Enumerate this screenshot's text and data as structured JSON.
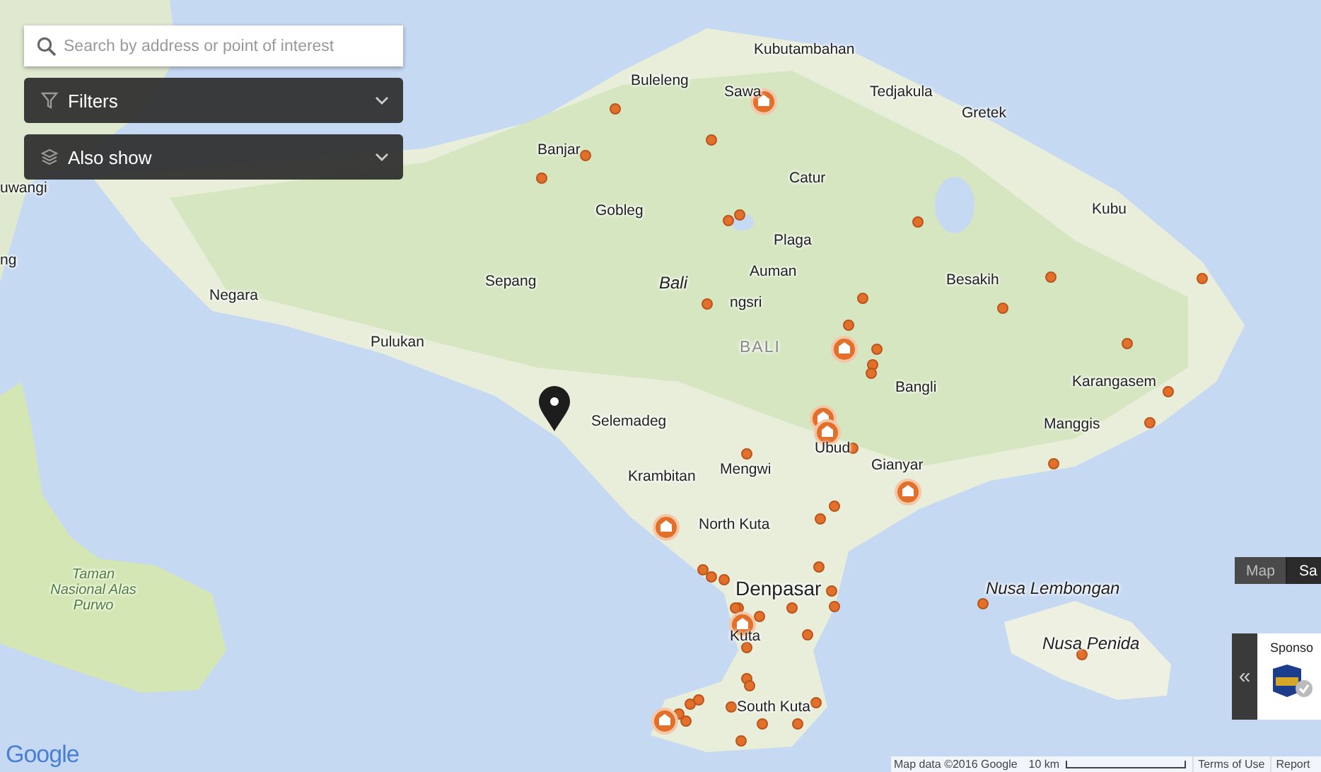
{
  "search": {
    "placeholder": "Search by address or point of interest"
  },
  "panels": [
    {
      "label": "Filters",
      "kind": "filter"
    },
    {
      "label": "Also show",
      "kind": "layers"
    }
  ],
  "map": {
    "labels": [
      {
        "text": "Kubutambahan",
        "kind": "town"
      },
      {
        "text": "Buleleng",
        "kind": "town"
      },
      {
        "text": "Sawa",
        "kind": "town"
      },
      {
        "text": "Tedjakula",
        "kind": "town"
      },
      {
        "text": "Gretek",
        "kind": "town"
      },
      {
        "text": "Banjar",
        "kind": "town"
      },
      {
        "text": "Catur",
        "kind": "town"
      },
      {
        "text": "Gobleg",
        "kind": "town"
      },
      {
        "text": "Kubu",
        "kind": "town"
      },
      {
        "text": "Plaga",
        "kind": "town"
      },
      {
        "text": "Auman",
        "kind": "town"
      },
      {
        "text": "Bali",
        "kind": "region"
      },
      {
        "text": "ngsri",
        "kind": "town"
      },
      {
        "text": "Negara",
        "kind": "town"
      },
      {
        "text": "Sepang",
        "kind": "town"
      },
      {
        "text": "BALI",
        "kind": "province"
      },
      {
        "text": "Besakih",
        "kind": "town"
      },
      {
        "text": "Pulukan",
        "kind": "town"
      },
      {
        "text": "Karangasem",
        "kind": "town"
      },
      {
        "text": "Bangli",
        "kind": "town"
      },
      {
        "text": "Manggis",
        "kind": "town"
      },
      {
        "text": "Selemadeg",
        "kind": "town"
      },
      {
        "text": "Ubud",
        "kind": "town"
      },
      {
        "text": "Gianyar",
        "kind": "town"
      },
      {
        "text": "Krambitan",
        "kind": "town"
      },
      {
        "text": "Mengwi",
        "kind": "town"
      },
      {
        "text": "North Kuta",
        "kind": "town"
      },
      {
        "text": "Denpasar",
        "kind": "city"
      },
      {
        "text": "Kuta",
        "kind": "town"
      },
      {
        "text": "South Kuta",
        "kind": "town"
      },
      {
        "text": "Nusa Lembongan",
        "kind": "region"
      },
      {
        "text": "Nusa Penida",
        "kind": "region"
      },
      {
        "text": "Taman Nasional Alas Purwo",
        "kind": "park"
      },
      {
        "text": "uwangi",
        "kind": "town"
      },
      {
        "text": "ng",
        "kind": "town"
      }
    ]
  },
  "map_type": [
    {
      "label": "Map",
      "selected": true
    },
    {
      "label": "Sa",
      "selected": false
    }
  ],
  "sponsor": {
    "toggle": "«",
    "label": "Sponso"
  },
  "attribution": {
    "map_data": "Map data ©2016 Google",
    "scale": "10 km",
    "links": [
      "Terms of Use",
      "Report"
    ]
  },
  "logo": "Google"
}
